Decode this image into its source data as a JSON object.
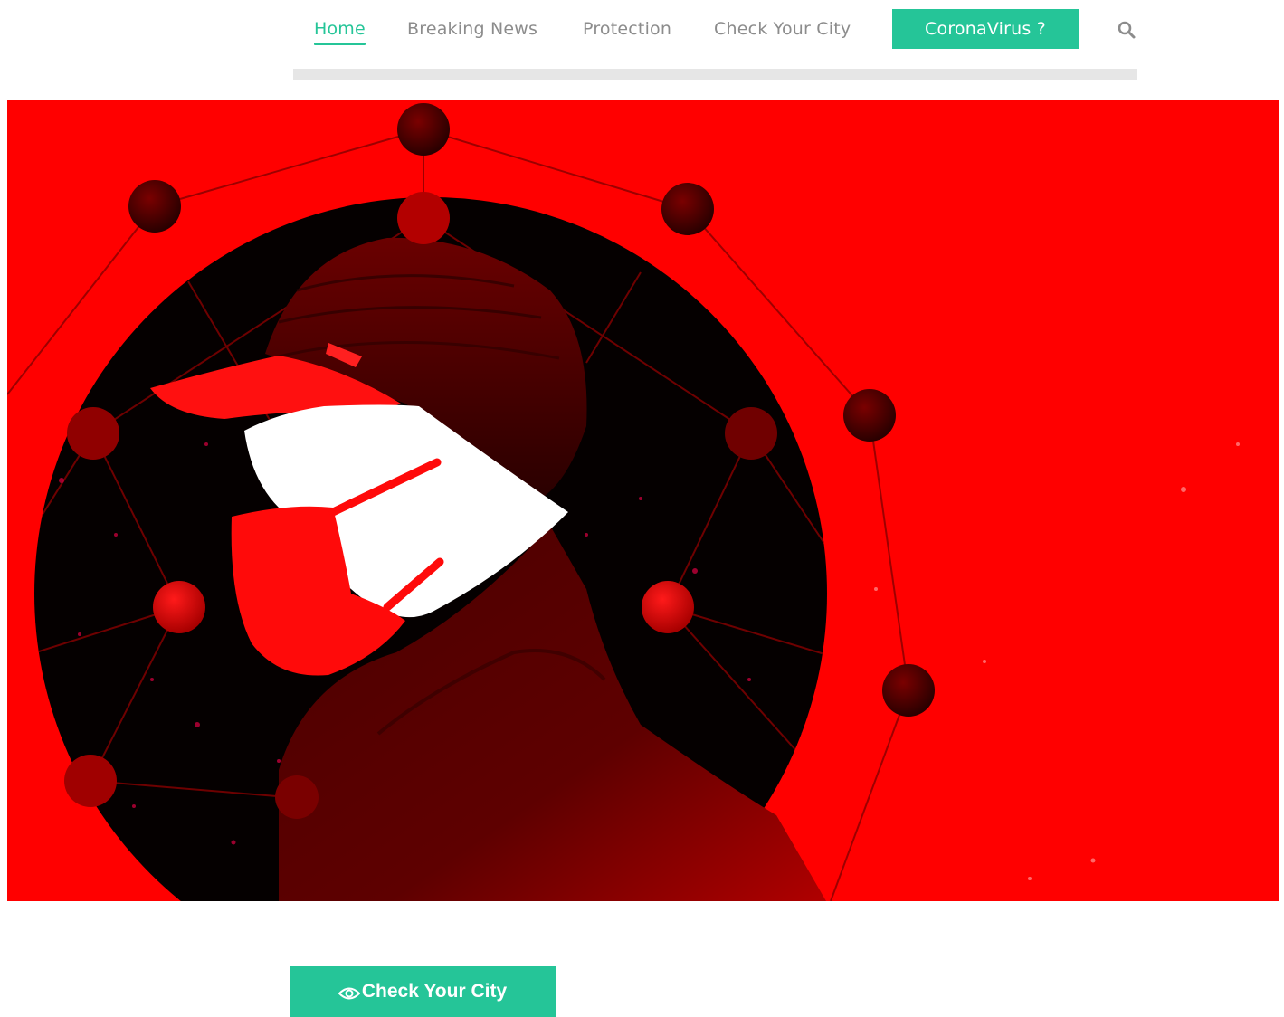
{
  "nav": {
    "items": [
      {
        "label": "Home",
        "active": true
      },
      {
        "label": "Breaking News",
        "active": false
      },
      {
        "label": "Protection",
        "active": false
      },
      {
        "label": "Check Your City",
        "active": false
      }
    ],
    "cta_label": "CoronaVirus ?",
    "search_icon": "search-icon"
  },
  "hero": {
    "image_description_icon": "masked-person-virus-illustration"
  },
  "main": {
    "check_city_button_label": "Check Your City",
    "check_city_button_icon": "eye-icon"
  },
  "colors": {
    "accent": "#25c598",
    "hero_red": "#ff0000",
    "nav_text": "#8c8c8c"
  }
}
